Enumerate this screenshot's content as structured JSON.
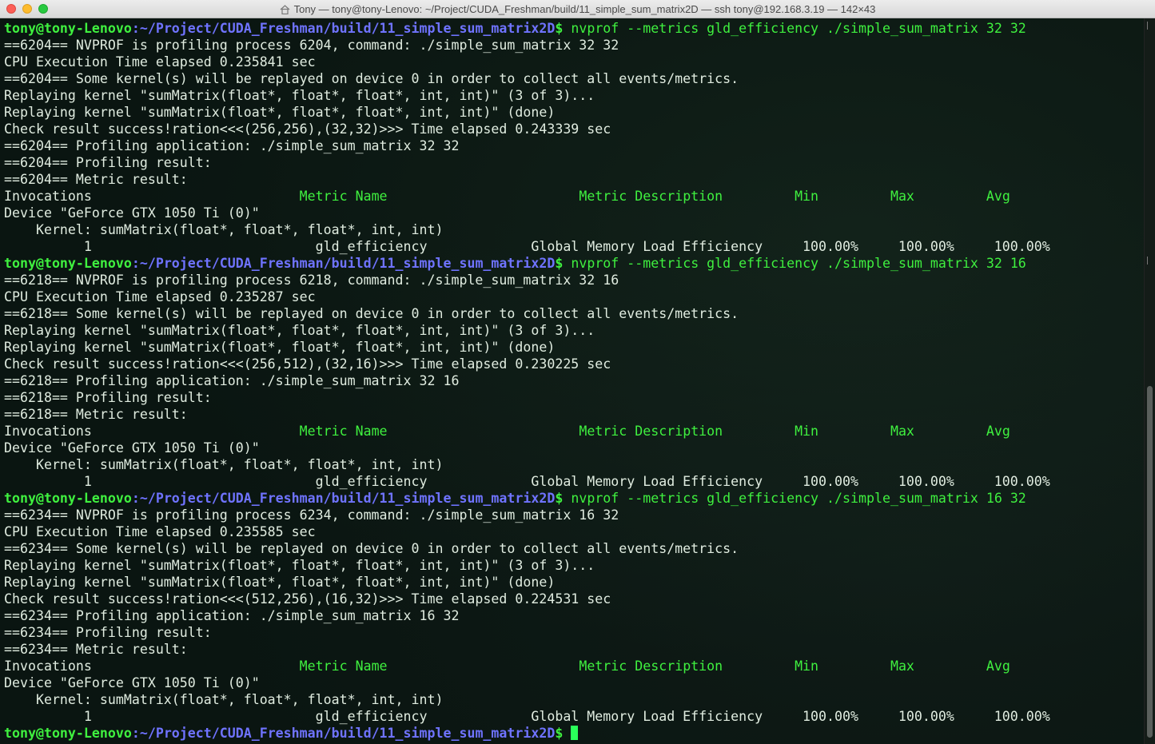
{
  "window": {
    "title": "Tony — tony@tony-Lenovo: ~/Project/CUDA_Freshman/build/11_simple_sum_matrix2D — ssh tony@192.168.3.19 — 142×43"
  },
  "prompt": {
    "user_host": "tony@tony-Lenovo",
    "path": ":~/Project/CUDA_Freshman/build/11_simple_sum_matrix2D",
    "sign": "$"
  },
  "sessions": [
    {
      "command": " nvprof --metrics gld_efficiency ./simple_sum_matrix 32 32",
      "output": [
        "==6204== NVPROF is profiling process 6204, command: ./simple_sum_matrix 32 32",
        "CPU Execution Time elapsed 0.235841 sec",
        "==6204== Some kernel(s) will be replayed on device 0 in order to collect all events/metrics.",
        "Replaying kernel \"sumMatrix(float*, float*, float*, int, int)\" (3 of 3)...",
        "Replaying kernel \"sumMatrix(float*, float*, float*, int, int)\" (done)",
        "Check result success!ration<<<(256,256),(32,32)>>> Time elapsed 0.243339 sec",
        "==6204== Profiling application: ./simple_sum_matrix 32 32",
        "==6204== Profiling result:",
        "==6204== Metric result:"
      ],
      "header_invocations": "Invocations",
      "header_mid": "                          Metric Name                        ",
      "header_desc": "Metric Description",
      "header_stats": "         Min         Max         Avg",
      "device": "Device \"GeForce GTX 1050 Ti (0)\"",
      "kernel": "    Kernel: sumMatrix(float*, float*, float*, int, int)",
      "result": "          1                            gld_efficiency             Global Memory Load Efficiency     100.00%     100.00%     100.00%"
    },
    {
      "command": " nvprof --metrics gld_efficiency ./simple_sum_matrix 32 16",
      "output": [
        "==6218== NVPROF is profiling process 6218, command: ./simple_sum_matrix 32 16",
        "CPU Execution Time elapsed 0.235287 sec",
        "==6218== Some kernel(s) will be replayed on device 0 in order to collect all events/metrics.",
        "Replaying kernel \"sumMatrix(float*, float*, float*, int, int)\" (3 of 3)...",
        "Replaying kernel \"sumMatrix(float*, float*, float*, int, int)\" (done)",
        "Check result success!ration<<<(256,512),(32,16)>>> Time elapsed 0.230225 sec",
        "==6218== Profiling application: ./simple_sum_matrix 32 16",
        "==6218== Profiling result:",
        "==6218== Metric result:"
      ],
      "header_invocations": "Invocations",
      "header_mid": "                          Metric Name                        ",
      "header_desc": "Metric Description",
      "header_stats": "         Min         Max         Avg",
      "device": "Device \"GeForce GTX 1050 Ti (0)\"",
      "kernel": "    Kernel: sumMatrix(float*, float*, float*, int, int)",
      "result": "          1                            gld_efficiency             Global Memory Load Efficiency     100.00%     100.00%     100.00%"
    },
    {
      "command": " nvprof --metrics gld_efficiency ./simple_sum_matrix 16 32",
      "output": [
        "==6234== NVPROF is profiling process 6234, command: ./simple_sum_matrix 16 32",
        "CPU Execution Time elapsed 0.235585 sec",
        "==6234== Some kernel(s) will be replayed on device 0 in order to collect all events/metrics.",
        "Replaying kernel \"sumMatrix(float*, float*, float*, int, int)\" (3 of 3)...",
        "Replaying kernel \"sumMatrix(float*, float*, float*, int, int)\" (done)",
        "Check result success!ration<<<(512,256),(16,32)>>> Time elapsed 0.224531 sec",
        "==6234== Profiling application: ./simple_sum_matrix 16 32",
        "==6234== Profiling result:",
        "==6234== Metric result:"
      ],
      "header_invocations": "Invocations",
      "header_mid": "                          Metric Name                        ",
      "header_desc": "Metric Description",
      "header_stats": "         Min         Max         Avg",
      "device": "Device \"GeForce GTX 1050 Ti (0)\"",
      "kernel": "    Kernel: sumMatrix(float*, float*, float*, int, int)",
      "result": "          1                            gld_efficiency             Global Memory Load Efficiency     100.00%     100.00%     100.00%"
    }
  ],
  "icons": {
    "title_icon": "home-folder-icon",
    "cursor": "block-cursor"
  },
  "colors": {
    "prompt_green": "#3ff03f",
    "path_blue": "#6f73ff",
    "text": "#e0ece0",
    "background": "#0a1511",
    "cursor": "#2aff5a"
  }
}
